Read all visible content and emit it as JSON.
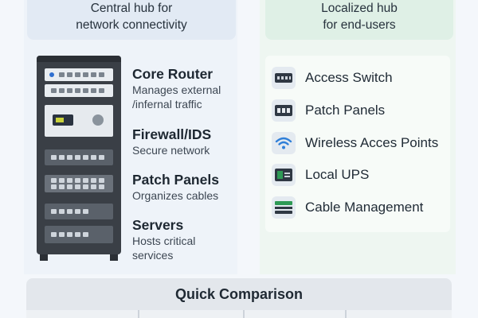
{
  "left_header": {
    "line1": "Central hub for",
    "line2": "network connectivity"
  },
  "right_header": {
    "line1": "Localized hub",
    "line2": "for end-users"
  },
  "rack_components": [
    {
      "title": "Core Router",
      "desc1": "Manages external",
      "desc2": "/infernal traffic"
    },
    {
      "title": "Firewall/IDS",
      "desc1": "Secure network",
      "desc2": ""
    },
    {
      "title": "Patch Panels",
      "desc1": "Organizes cables",
      "desc2": ""
    },
    {
      "title": "Servers",
      "desc1": "Hosts critical",
      "desc2": "services"
    }
  ],
  "local_items": [
    {
      "label": "Access Switch",
      "icon": "switch-icon"
    },
    {
      "label": "Patch Panels",
      "icon": "patch-panel-icon"
    },
    {
      "label": "Wireless Acces Points",
      "icon": "wifi-icon"
    },
    {
      "label": "Local UPS",
      "icon": "ups-icon"
    },
    {
      "label": "Cable Management",
      "icon": "cable-management-icon"
    }
  ],
  "comparison": {
    "title": "Quick Comparison"
  },
  "colors": {
    "left_bg": "#eef3f9",
    "right_bg": "#eef6f1",
    "rack": "#3a3f46",
    "wifi": "#2f7fd8",
    "ups_green": "#2e9a55"
  }
}
